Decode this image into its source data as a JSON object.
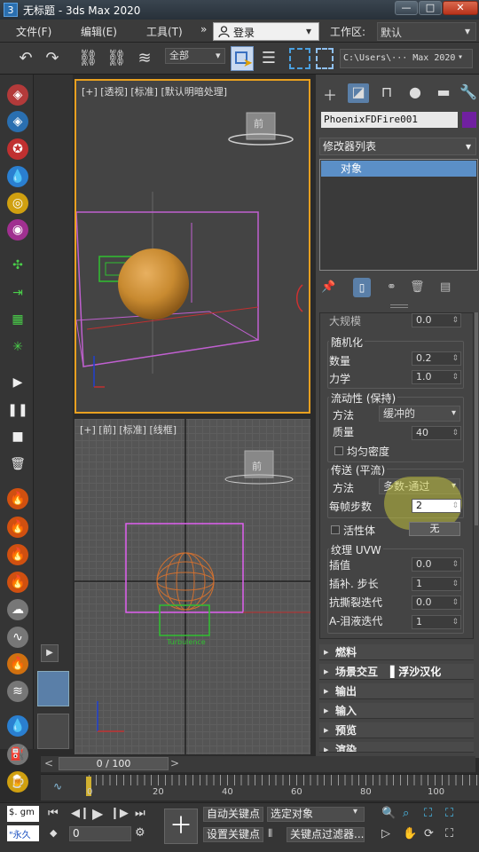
{
  "window": {
    "title": "无标题 - 3ds Max 2020",
    "app_icon": "3",
    "minimize": "—",
    "maximize": "□",
    "close": "✕"
  },
  "menu": {
    "items": [
      "文件(F)",
      "编辑(E)",
      "工具(T)"
    ],
    "more": "»",
    "login": "登录",
    "workspace_label": "工作区:",
    "workspace_value": "默认"
  },
  "toolbar": {
    "selection_filter": "全部",
    "project_path": "C:\\Users\\··· Max 2020"
  },
  "viewport_top": {
    "label": "[+] [透视] [标准] [默认明暗处理]",
    "nav_cube_label": "前"
  },
  "viewport_bottom": {
    "label": "[+] [前] [标准] [线框]",
    "nav_cube_label": "前",
    "turbulence_label": "Turbulence"
  },
  "command_panel": {
    "object_name": "PhoenixFDFire001",
    "object_color": "#7020a0",
    "modifier_list": "修改器列表",
    "stack_item": "对象"
  },
  "rollout": {
    "clipped_row": "大规模",
    "clipped_value": "0.0",
    "randomize": {
      "title": "随机化",
      "amount_label": "数量",
      "amount": "0.2",
      "force_label": "力学",
      "force": "1.0"
    },
    "fluidity": {
      "title": "流动性 (保持)",
      "method_label": "方法",
      "method": "缓冲的",
      "quality_label": "质量",
      "quality": "40",
      "uniform_density": "均匀密度"
    },
    "advection": {
      "title": "传送 (平流)",
      "method_label": "方法",
      "method": "多数-通过",
      "steps_label": "每帧步数",
      "steps": "2"
    },
    "active_body": {
      "label": "活性体",
      "value": "无"
    },
    "texture_uvw": {
      "title": "纹理 UVW",
      "interp_label": "插值",
      "interp": "0.0",
      "interp_step_label": "插补. 步长",
      "interp_step": "1",
      "anti_tear_label": "抗撕裂迭代",
      "anti_tear": "0.0",
      "ablend_label": "A-泪液迭代",
      "ablend": "1"
    }
  },
  "rollups": [
    "燃料",
    "场景交互",
    "输出",
    "输入",
    "预览",
    "渲染"
  ],
  "watermark": "▌浮沙汉化",
  "timeline": {
    "frame": "0 / 100",
    "ticks": [
      "0",
      "20",
      "40",
      "60",
      "80",
      "100"
    ]
  },
  "bottom": {
    "script_label": "$. gm",
    "script2_label": "\"永久",
    "frame_input": "0",
    "auto_key": "自动关键点",
    "set_key": "设置关键点",
    "selected_object": "选定对象",
    "key_filter": "关键点过滤器..."
  }
}
